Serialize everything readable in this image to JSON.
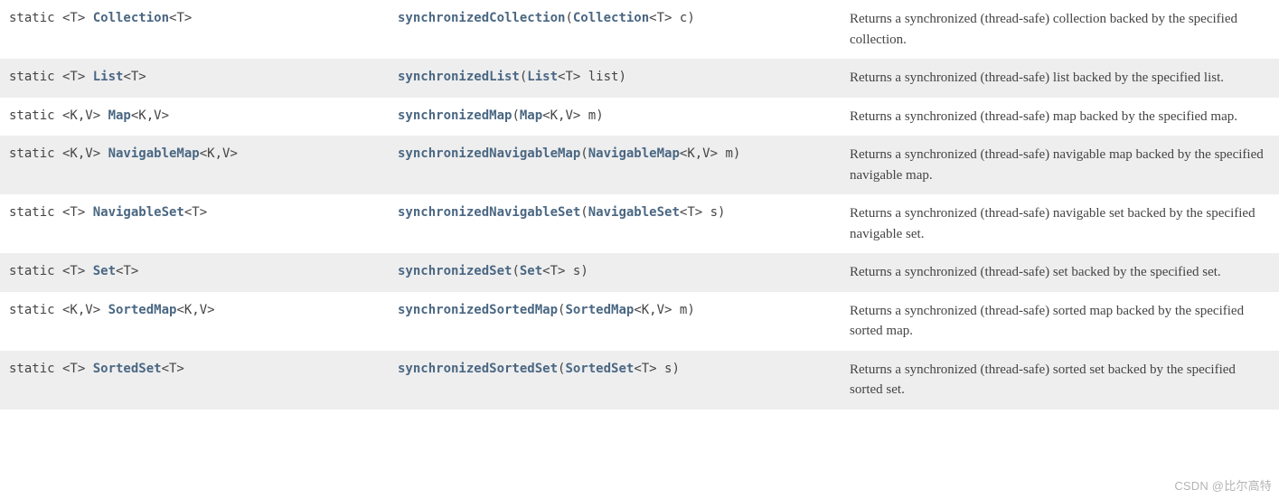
{
  "rows": [
    {
      "prefix": "static <T> ",
      "returnType": "Collection",
      "returnSuffix": "<T>",
      "method": "synchronizedCollection",
      "paramType": "Collection",
      "paramSuffix": "<T> c",
      "desc": "Returns a synchronized (thread-safe) collection backed by the specified collection."
    },
    {
      "prefix": "static <T> ",
      "returnType": "List",
      "returnSuffix": "<T>",
      "method": "synchronizedList",
      "paramType": "List",
      "paramSuffix": "<T> list",
      "desc": "Returns a synchronized (thread-safe) list backed by the specified list."
    },
    {
      "prefix": "static <K,V> ",
      "returnType": "Map",
      "returnSuffix": "<K,V>",
      "method": "synchronizedMap",
      "paramType": "Map",
      "paramSuffix": "<K,V> m",
      "desc": "Returns a synchronized (thread-safe) map backed by the specified map."
    },
    {
      "prefix": "static <K,V> ",
      "returnType": "NavigableMap",
      "returnSuffix": "<K,V>",
      "method": "synchronizedNavigableMap",
      "paramType": "NavigableMap",
      "paramSuffix": "<K,V> m",
      "desc": "Returns a synchronized (thread-safe) navigable map backed by the specified navigable map."
    },
    {
      "prefix": "static <T> ",
      "returnType": "NavigableSet",
      "returnSuffix": "<T>",
      "method": "synchronizedNavigableSet",
      "paramType": "NavigableSet",
      "paramSuffix": "<T> s",
      "desc": "Returns a synchronized (thread-safe) navigable set backed by the specified navigable set."
    },
    {
      "prefix": "static <T> ",
      "returnType": "Set",
      "returnSuffix": "<T>",
      "method": "synchronizedSet",
      "paramType": "Set",
      "paramSuffix": "<T> s",
      "desc": "Returns a synchronized (thread-safe) set backed by the specified set."
    },
    {
      "prefix": "static <K,V> ",
      "returnType": "SortedMap",
      "returnSuffix": "<K,V>",
      "method": "synchronizedSortedMap",
      "paramType": "SortedMap",
      "paramSuffix": "<K,V> m",
      "desc": "Returns a synchronized (thread-safe) sorted map backed by the specified sorted map."
    },
    {
      "prefix": "static <T> ",
      "returnType": "SortedSet",
      "returnSuffix": "<T>",
      "method": "synchronizedSortedSet",
      "paramType": "SortedSet",
      "paramSuffix": "<T> s",
      "desc": "Returns a synchronized (thread-safe) sorted set backed by the specified sorted set."
    }
  ],
  "watermark": "CSDN @比尔高特"
}
